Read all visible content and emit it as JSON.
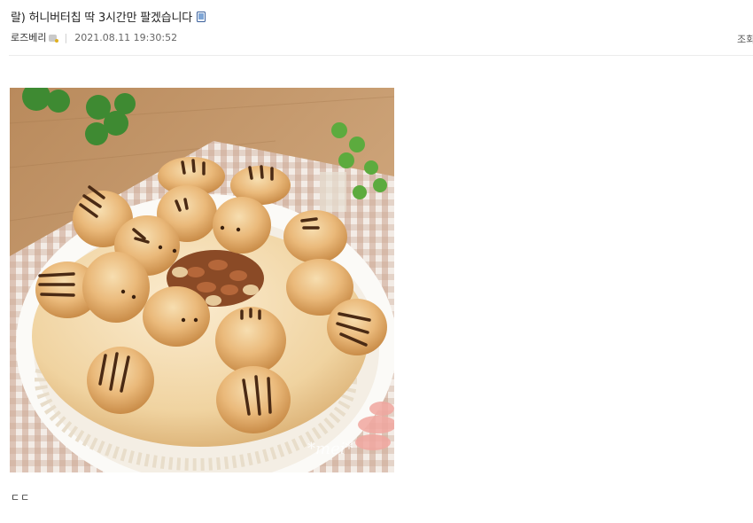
{
  "post": {
    "title": "랄) 허니버터칩 딱 3시간만 팔겠습니다",
    "author": "로즈베리",
    "date": "2021.08.11 19:30:52",
    "views_label": "조회",
    "body_text": "ㄷㄷ",
    "watermark": "*mei*"
  },
  "icons": {
    "title_badge": "mobile-icon",
    "author_badge": "member-level-icon"
  },
  "colors": {
    "title_text": "#222222",
    "meta_text": "#555555",
    "divider": "#ebebeb",
    "mobile_icon": "#3a5f9a"
  }
}
